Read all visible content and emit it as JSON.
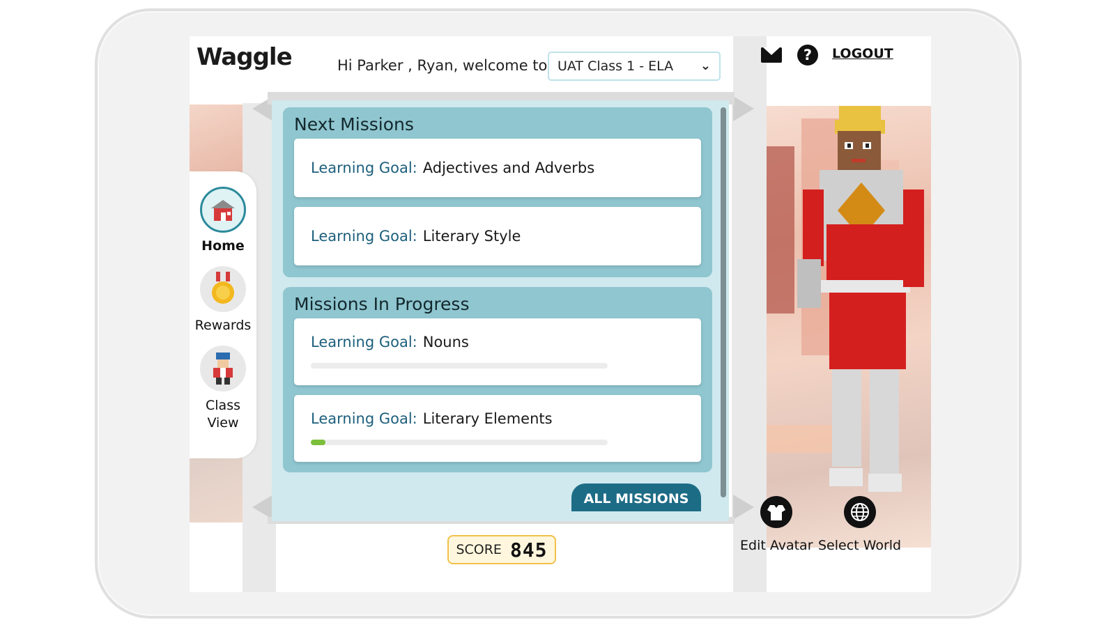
{
  "header": {
    "logo": "Waggle",
    "welcome": "Hi Parker , Ryan, welcome to",
    "class_selected": "UAT Class 1 - ELA",
    "logout": "LOGOUT"
  },
  "icons": {
    "mail": "mail-icon",
    "help": "help-icon",
    "dropdown": "chevron-down-icon",
    "home": "home-icon",
    "rewards": "medal-icon",
    "class_view": "class-avatar-icon",
    "edit_avatar": "shirt-icon",
    "select_world": "globe-icon"
  },
  "sidebar": {
    "items": [
      {
        "label": "Home",
        "active": true
      },
      {
        "label": "Rewards",
        "active": false
      },
      {
        "label": "Class View",
        "active": false
      }
    ]
  },
  "missions": {
    "next_title": "Next Missions",
    "in_progress_title": "Missions In Progress",
    "goal_prefix": "Learning Goal:",
    "next": [
      {
        "topic": "Adjectives and Adverbs"
      },
      {
        "topic": "Literary Style"
      }
    ],
    "in_progress": [
      {
        "topic": "Nouns",
        "progress": 0.0
      },
      {
        "topic": "Literary Elements",
        "progress": 0.05
      }
    ],
    "all_button": "ALL MISSIONS"
  },
  "score": {
    "label": "SCORE",
    "value": "845"
  },
  "actions": {
    "edit_avatar": "Edit Avatar",
    "select_world": "Select World"
  },
  "colors": {
    "accent": "#1d6c86",
    "panel": "#8fc6d0",
    "progress_fill": "#7cbf3a",
    "score_border": "#f2c14a"
  }
}
